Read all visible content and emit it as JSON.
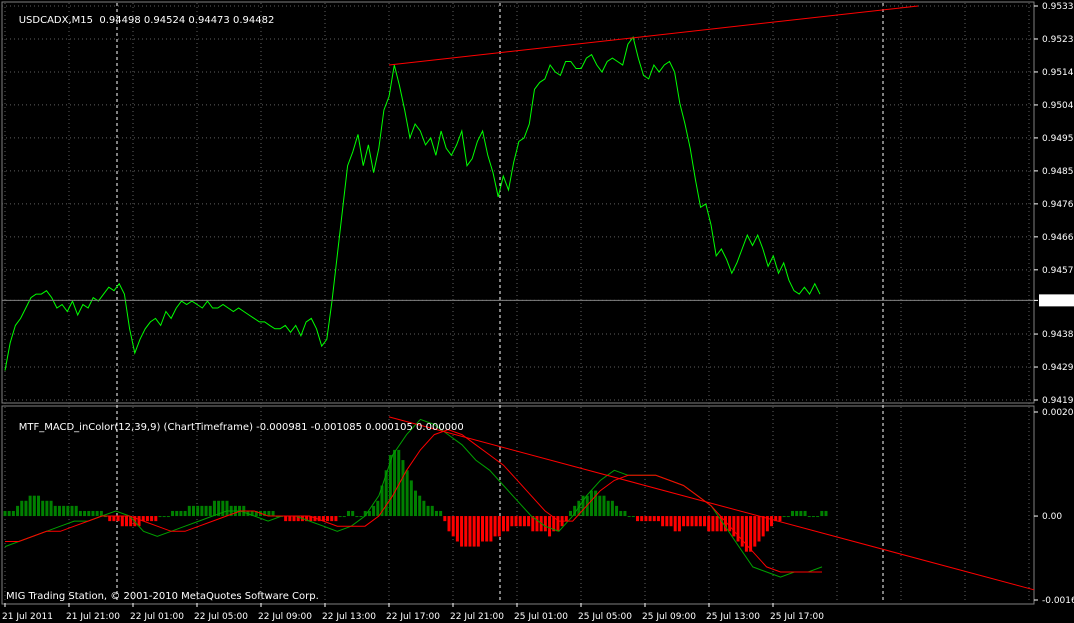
{
  "main_header": {
    "symbol": "USDCADX,M15",
    "quote": "0.94498 0.94524 0.94473 0.94482"
  },
  "indicator_header": {
    "name": "MTF_MACD_inColor(12,39,9) (ChartTimeframe)",
    "values": "-0.000981 -0.001085 0.000105 0.000000"
  },
  "footer": {
    "text": "MIG Trading Station, © 2001-2010 MetaQuotes Software Corp."
  },
  "colors": {
    "price": "#00ff00",
    "trendline": "#ff0000",
    "hist_pos": "#008000",
    "hist_neg": "#ff0000",
    "macd": "#00a000",
    "signal": "#ff0000",
    "grid": "#606060",
    "separator": "#ffffff",
    "text": "#ffffff"
  },
  "chart_data": [
    {
      "type": "line",
      "title": "USDCADX,M15",
      "y_ticks": [
        "0.95330",
        "0.95235",
        "0.95140",
        "0.95045",
        "0.94950",
        "0.94855",
        "0.94760",
        "0.94665",
        "0.94570",
        "0.94482",
        "0.94385",
        "0.94290",
        "0.94195"
      ],
      "ylim": [
        0.94195,
        0.9533
      ],
      "current_price": "0.94482",
      "x_ticks": [
        "21 Jul 2011",
        "21 Jul 21:00",
        "22 Jul 01:00",
        "22 Jul 05:00",
        "22 Jul 09:00",
        "22 Jul 13:00",
        "22 Jul 17:00",
        "22 Jul 21:00",
        "25 Jul 01:00",
        "25 Jul 05:00",
        "25 Jul 09:00",
        "25 Jul 13:00",
        "25 Jul 17:00"
      ],
      "series": [
        {
          "values": [
            0.9428,
            0.9436,
            0.9441,
            0.9443,
            0.9446,
            0.9449,
            0.945,
            0.945,
            0.9451,
            0.9449,
            0.9446,
            0.9447,
            0.9445,
            0.9448,
            0.9444,
            0.9447,
            0.9446,
            0.9449,
            0.9448,
            0.945,
            0.9452,
            0.9451,
            0.9453,
            0.945,
            0.944,
            0.9433,
            0.9437,
            0.944,
            0.9442,
            0.9443,
            0.9441,
            0.9445,
            0.9443,
            0.9446,
            0.9448,
            0.9447,
            0.9448,
            0.9447,
            0.9446,
            0.9448,
            0.9446,
            0.9446,
            0.9447,
            0.9446,
            0.9445,
            0.9446,
            0.9445,
            0.9444,
            0.9443,
            0.9442,
            0.9442,
            0.9441,
            0.944,
            0.944,
            0.9441,
            0.9439,
            0.9441,
            0.9438,
            0.9442,
            0.9443,
            0.944,
            0.9435,
            0.9437,
            0.9448,
            0.9461,
            0.9474,
            0.9487,
            0.9491,
            0.9496,
            0.9487,
            0.9493,
            0.9485,
            0.9492,
            0.9503,
            0.9507,
            0.9516,
            0.951,
            0.9503,
            0.9495,
            0.9499,
            0.9497,
            0.9493,
            0.9495,
            0.949,
            0.9497,
            0.9492,
            0.949,
            0.9493,
            0.9497,
            0.9487,
            0.9489,
            0.9494,
            0.9497,
            0.949,
            0.9485,
            0.9478,
            0.9484,
            0.948,
            0.9488,
            0.9494,
            0.9495,
            0.9499,
            0.9509,
            0.9511,
            0.9512,
            0.9516,
            0.9514,
            0.9513,
            0.9517,
            0.9517,
            0.9515,
            0.9515,
            0.9518,
            0.9519,
            0.9516,
            0.9514,
            0.9517,
            0.9518,
            0.9517,
            0.9516,
            0.9522,
            0.9524,
            0.9518,
            0.9513,
            0.9512,
            0.9516,
            0.9514,
            0.9516,
            0.9517,
            0.9514,
            0.9505,
            0.9499,
            0.9492,
            0.9483,
            0.9475,
            0.9476,
            0.947,
            0.9461,
            0.9463,
            0.946,
            0.9456,
            0.9459,
            0.9463,
            0.9467,
            0.9464,
            0.9467,
            0.9463,
            0.9458,
            0.9461,
            0.9456,
            0.9459,
            0.9454,
            0.9451,
            0.945,
            0.9452,
            0.945,
            0.9453,
            0.945
          ]
        }
      ],
      "trendline": {
        "from": [
          "22 Jul 17:00",
          0.9516
        ],
        "to": [
          "25 Jul 17:00",
          0.9533
        ]
      }
    },
    {
      "type": "bar",
      "title": "MTF_MACD_inColor(12,39,9) (ChartTimeframe)",
      "y_ticks": [
        "0.002045",
        "0.00",
        "-0.00165"
      ],
      "ylim": [
        -0.00165,
        0.002045
      ],
      "histogram": [
        0.0001,
        0.0001,
        0.0001,
        0.0002,
        0.0003,
        0.0003,
        0.0004,
        0.0004,
        0.0004,
        0.0003,
        0.0003,
        0.0003,
        0.0002,
        0.0002,
        0.0002,
        0.0002,
        0.0002,
        0.0002,
        0.0001,
        0.0001,
        0.0001,
        0.0001,
        0.0001,
        0.0001,
        0.0,
        -0.0001,
        -0.0001,
        -0.0001,
        -0.0002,
        -0.0002,
        -0.0002,
        -0.0002,
        -0.0002,
        -0.0001,
        -0.0001,
        -0.0001,
        -0.0001,
        0.0,
        0.0,
        0.0,
        0.0001,
        0.0001,
        0.0001,
        0.0001,
        0.0002,
        0.0002,
        0.0002,
        0.0002,
        0.0002,
        0.0002,
        0.0003,
        0.0003,
        0.0003,
        0.0003,
        0.0002,
        0.0002,
        0.0002,
        0.0002,
        0.0001,
        0.0001,
        0.0001,
        0.0001,
        0.0001,
        0.0001,
        0.0001,
        0.0,
        0.0,
        -0.0001,
        -0.0001,
        -0.0001,
        -0.0001,
        -0.0001,
        -0.0001,
        -0.0001,
        -0.0001,
        -0.0001,
        -0.0001,
        -0.0001,
        -0.0001,
        -0.0001,
        0.0,
        0.0,
        0.0001,
        0.0001,
        0.0,
        0.0,
        0.0001,
        0.0001,
        0.0002,
        0.0003,
        0.0006,
        0.0009,
        0.0012,
        0.0013,
        0.0013,
        0.0011,
        0.0009,
        0.0007,
        0.0005,
        0.0004,
        0.0003,
        0.0002,
        0.0002,
        0.0001,
        0.0001,
        -0.0001,
        -0.0003,
        -0.0004,
        -0.0005,
        -0.0006,
        -0.0006,
        -0.0006,
        -0.0006,
        -0.0006,
        -0.0005,
        -0.0005,
        -0.0005,
        -0.0004,
        -0.0004,
        -0.0003,
        -0.0003,
        -0.0002,
        -0.0002,
        -0.0002,
        -0.0002,
        -0.0002,
        -0.0003,
        -0.0003,
        -0.0003,
        -0.0003,
        -0.0004,
        -0.0003,
        -0.0003,
        -0.0002,
        -0.0001,
        0.0001,
        0.0002,
        0.0003,
        0.0004,
        0.0004,
        0.0005,
        0.0005,
        0.0004,
        0.0004,
        0.0003,
        0.0003,
        0.0002,
        0.0001,
        0.0001,
        0.0,
        0.0,
        -0.0001,
        -0.0001,
        -0.0001,
        -0.0001,
        -0.0001,
        -0.0001,
        -0.0002,
        -0.0002,
        -0.0002,
        -0.0003,
        -0.0003,
        -0.0002,
        -0.0002,
        -0.0002,
        -0.0002,
        -0.0002,
        -0.0002,
        -0.0003,
        -0.0003,
        -0.0003,
        -0.0003,
        -0.0003,
        -0.0003,
        -0.0004,
        -0.0005,
        -0.0006,
        -0.0007,
        -0.0007,
        -0.0006,
        -0.0005,
        -0.0004,
        -0.0003,
        -0.0002,
        -0.0001,
        -0.0001,
        0.0,
        0.0,
        0.0001,
        0.0001,
        0.0001,
        0.0001,
        0.0,
        0.0,
        0.0,
        0.0001,
        0.0001
      ],
      "series": [
        {
          "values": [
            -0.0006,
            -0.0005,
            -0.0004,
            -0.0003,
            -0.0002,
            -0.0001,
            -0.0001,
            0.0,
            0.0001,
            0.0,
            -0.0003,
            -0.0004,
            -0.0003,
            -0.0002,
            -0.0001,
            0.0,
            0.0001,
            0.0001,
            0.0,
            -0.0001,
            0.0,
            0.0,
            -0.0001,
            -0.0002,
            -0.0003,
            -0.0002,
            0.0,
            0.0004,
            0.0012,
            0.0016,
            0.0019,
            0.0018,
            0.0016,
            0.0014,
            0.0011,
            0.0009,
            0.0006,
            0.0003,
            0.0,
            -0.0002,
            -0.0003,
            0.0,
            0.0004,
            0.0007,
            0.0009,
            0.0008,
            0.0008,
            0.0008,
            0.0007,
            0.0006,
            0.0004,
            0.0002,
            -0.0002,
            -0.0006,
            -0.001,
            -0.0011,
            -0.0012,
            -0.0011,
            -0.0011,
            -0.001
          ]
        },
        {
          "values": [
            -0.0005,
            -0.0005,
            -0.0004,
            -0.0003,
            -0.0003,
            -0.0002,
            -0.0001,
            0.0,
            0.0,
            0.0,
            -0.0001,
            -0.0002,
            -0.0003,
            -0.0003,
            -0.0002,
            -0.0001,
            0.0,
            0.0001,
            0.0001,
            0.0,
            0.0,
            0.0,
            0.0,
            -0.0001,
            -0.0002,
            -0.0002,
            -0.0002,
            0.0,
            0.0004,
            0.0009,
            0.0013,
            0.0016,
            0.0017,
            0.0016,
            0.0014,
            0.0012,
            0.001,
            0.0007,
            0.0004,
            0.0001,
            -0.0001,
            -0.0001,
            0.0002,
            0.0005,
            0.0007,
            0.0008,
            0.0008,
            0.0008,
            0.0007,
            0.0006,
            0.0004,
            0.0002,
            -0.0001,
            -0.0004,
            -0.0007,
            -0.001,
            -0.0011,
            -0.0011,
            -0.0011,
            -0.0011
          ]
        }
      ],
      "trendline": {
        "from": [
          "22 Jul 17:00",
          0.00195
        ],
        "to": [
          "25 Jul 21:00",
          -0.00145
        ]
      }
    }
  ]
}
